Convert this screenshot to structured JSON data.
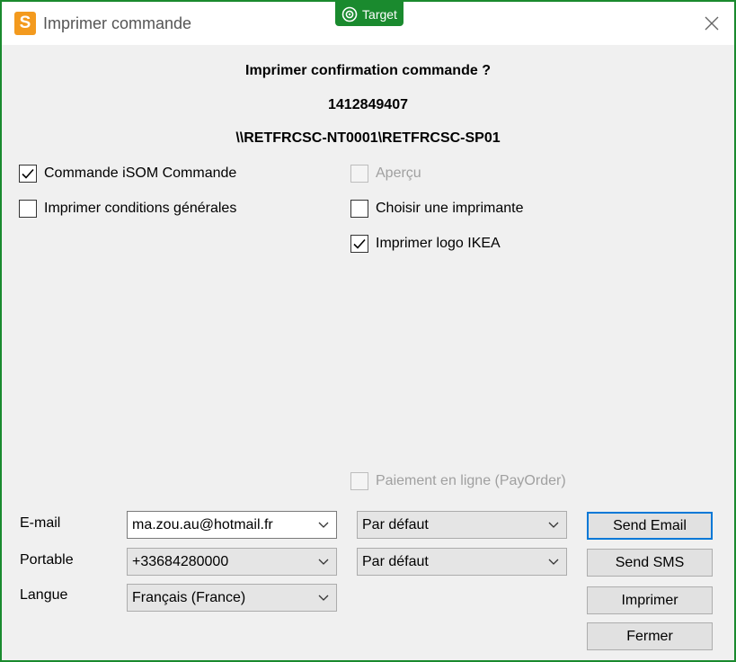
{
  "window": {
    "title": "Imprimer commande",
    "app_icon_letter": "S",
    "badge": "Target"
  },
  "header": {
    "question": "Imprimer confirmation commande ?",
    "order_number": "1412849407",
    "printer_path": "\\\\RETFRCSC-NT0001\\RETFRCSC-SP01"
  },
  "options": {
    "commande_isom": {
      "label": "Commande iSOM Commande",
      "checked": true,
      "enabled": true
    },
    "conditions": {
      "label": "Imprimer conditions générales",
      "checked": false,
      "enabled": true
    },
    "apercu": {
      "label": "Aperçu",
      "checked": false,
      "enabled": false
    },
    "choisir_imprimante": {
      "label": "Choisir une imprimante",
      "checked": false,
      "enabled": true
    },
    "logo_ikea": {
      "label": "Imprimer logo IKEA",
      "checked": true,
      "enabled": true
    },
    "paiement": {
      "label": "Paiement en ligne (PayOrder)",
      "checked": false,
      "enabled": false
    }
  },
  "form": {
    "email_label": "E-mail",
    "email_value": "ma.zou.au@hotmail.fr",
    "email_template": "Par défaut",
    "phone_label": "Portable",
    "phone_value": "+33684280000",
    "sms_template": "Par défaut",
    "language_label": "Langue",
    "language_value": "Français (France)"
  },
  "buttons": {
    "send_email": "Send Email",
    "send_sms": "Send SMS",
    "print": "Imprimer",
    "close": "Fermer"
  },
  "icons": {
    "close": "close-icon",
    "checkmark": "checkmark-icon",
    "dropdown": "chevron-down-icon",
    "target": "target-icon"
  },
  "colors": {
    "accent_border": "#1a8a2e",
    "app_icon": "#f39a1e",
    "default_button": "#0078d7"
  }
}
